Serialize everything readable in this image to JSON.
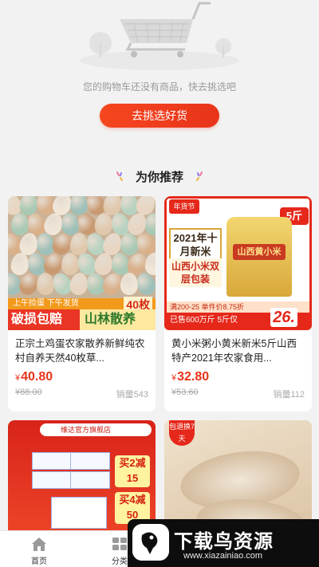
{
  "empty_cart": {
    "message": "您的购物车还没有商品，快去挑选吧",
    "button_label": "去挑选好货"
  },
  "recommend": {
    "title": "为你推荐"
  },
  "products": [
    {
      "title": "正宗土鸡蛋农家散养新鲜纯农村自养天然40枚草...",
      "currency": "¥",
      "price": "40.80",
      "original_price": "¥88.00",
      "sales": "销量543",
      "image_text": {
        "banner_top": "上午捡蛋 下午发货",
        "count": "40枚",
        "left": "破损包赔",
        "right": "山林散养"
      }
    },
    {
      "title": "黄小米粥小黄米新米5斤山西特产2021年农家食用...",
      "currency": "¥",
      "price": "32.80",
      "original_price": "¥53.60",
      "sales": "销量112",
      "image_text": {
        "tag": "年货节",
        "weight": "5斤",
        "year": "2021年十月新米",
        "name": "山西小米双层包装",
        "bag_label": "山西黄小米",
        "promo": "满200-25 单件价8.75折",
        "sold": "已售600万斤 5斤仅",
        "price": "26."
      }
    },
    {
      "image_text": {
        "shop": "维达官方旗舰店",
        "sale1": "买2减15",
        "sale2": "买4减50"
      }
    },
    {
      "image_text": {
        "tag": "包退换7天"
      }
    }
  ],
  "tabbar": {
    "items": [
      {
        "label": "首页",
        "icon": "home-icon"
      },
      {
        "label": "分类",
        "icon": "category-icon"
      }
    ]
  },
  "watermark": {
    "title": "下载鸟资源",
    "url": "www.xiazainiao.com"
  },
  "colors": {
    "accent": "#e8341a",
    "background": "#f2f2f2"
  }
}
